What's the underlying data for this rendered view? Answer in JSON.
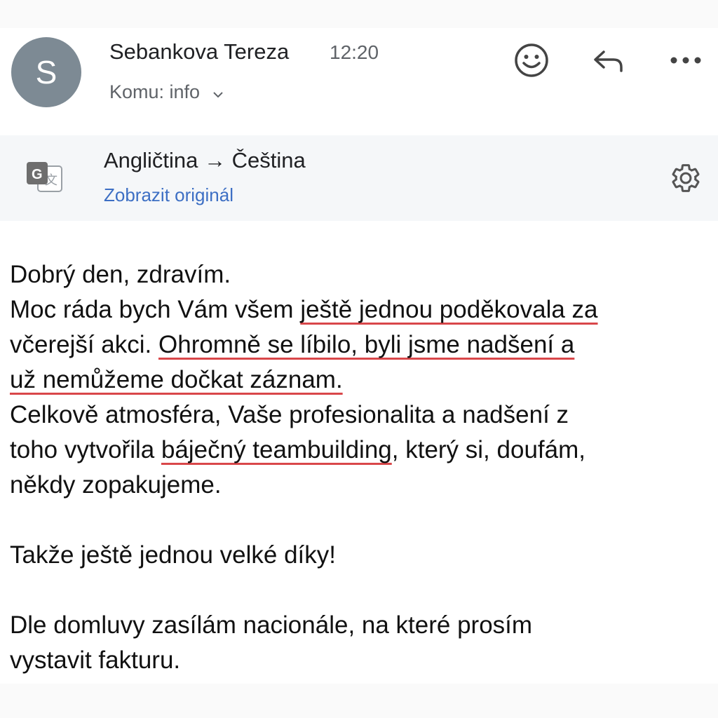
{
  "email": {
    "sender_initial": "S",
    "sender_name": "Sebankova Tereza",
    "time": "12:20",
    "recipient": "Komu: info"
  },
  "translation": {
    "languages": "Angličtina → Čeština",
    "show_original": "Zobrazit originál"
  },
  "body": {
    "line1": "Dobrý den, zdravím.",
    "line2_a": "Moc ráda bych Vám všem ",
    "line2_b": "ještě jednou poděkovala za",
    "line3_a": "včerejší akci. ",
    "line3_b": "Ohromně se líbilo, byli jsme nadšení a",
    "line4": "už nemůžeme dočkat záznam.",
    "line5": "Celkově atmosféra, Vaše profesionalita a nadšení z",
    "line6_a": "toho vytvořila ",
    "line6_b": "báječný teambuilding",
    "line6_c": ", který si, doufám,",
    "line7": "někdy zopakujeme.",
    "line8": "Takže ještě jednou velké díky!",
    "line9": "Dle domluvy zasílám nacionále, na které prosím",
    "line10": "vystavit fakturu."
  },
  "icons": {
    "emoji": "smiley-icon",
    "reply": "reply-arrow-icon",
    "more": "more-dots-icon",
    "translate": "translate-icon",
    "settings": "gear-icon",
    "recipient_expand": "chevron-down-icon"
  },
  "colors": {
    "avatar": "#7d8a94",
    "link": "#3d6fc4",
    "underline": "#d9474a",
    "translate_bar": "#f5f7f9"
  }
}
